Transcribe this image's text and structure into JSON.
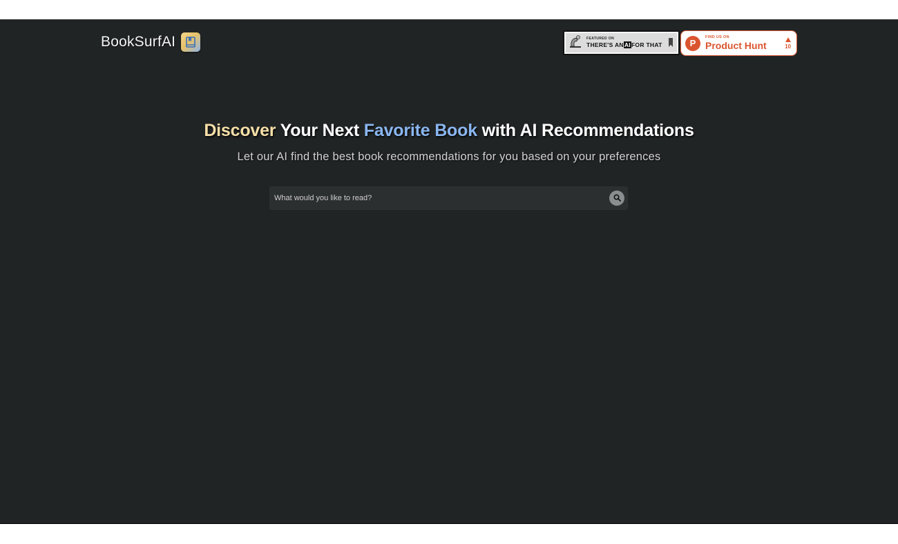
{
  "brand": {
    "name": "BookSurfAI",
    "icon": "bookmark-book-icon"
  },
  "badges": {
    "taaft": {
      "small": "FEATURED ON",
      "pre": "THERE'S AN",
      "ai": "AI",
      "post": "FOR THAT",
      "icon": "robot-icon"
    },
    "producthunt": {
      "small": "FIND US ON",
      "big": "Product Hunt",
      "logo": "P",
      "votes": "10",
      "color": "#da552f"
    }
  },
  "hero": {
    "title": {
      "discover": "Discover",
      "middle": " Your Next ",
      "favorite": "Favorite Book",
      "end": " with AI Recommendations"
    },
    "subtitle": "Let our AI find the best book recommendations for you based on your preferences"
  },
  "search": {
    "placeholder": "What would you like to read?",
    "value": "",
    "icon": "search-icon"
  },
  "colors": {
    "background": "#212425",
    "discover": "#f6dfa8",
    "favorite": "#8ab6f0"
  }
}
